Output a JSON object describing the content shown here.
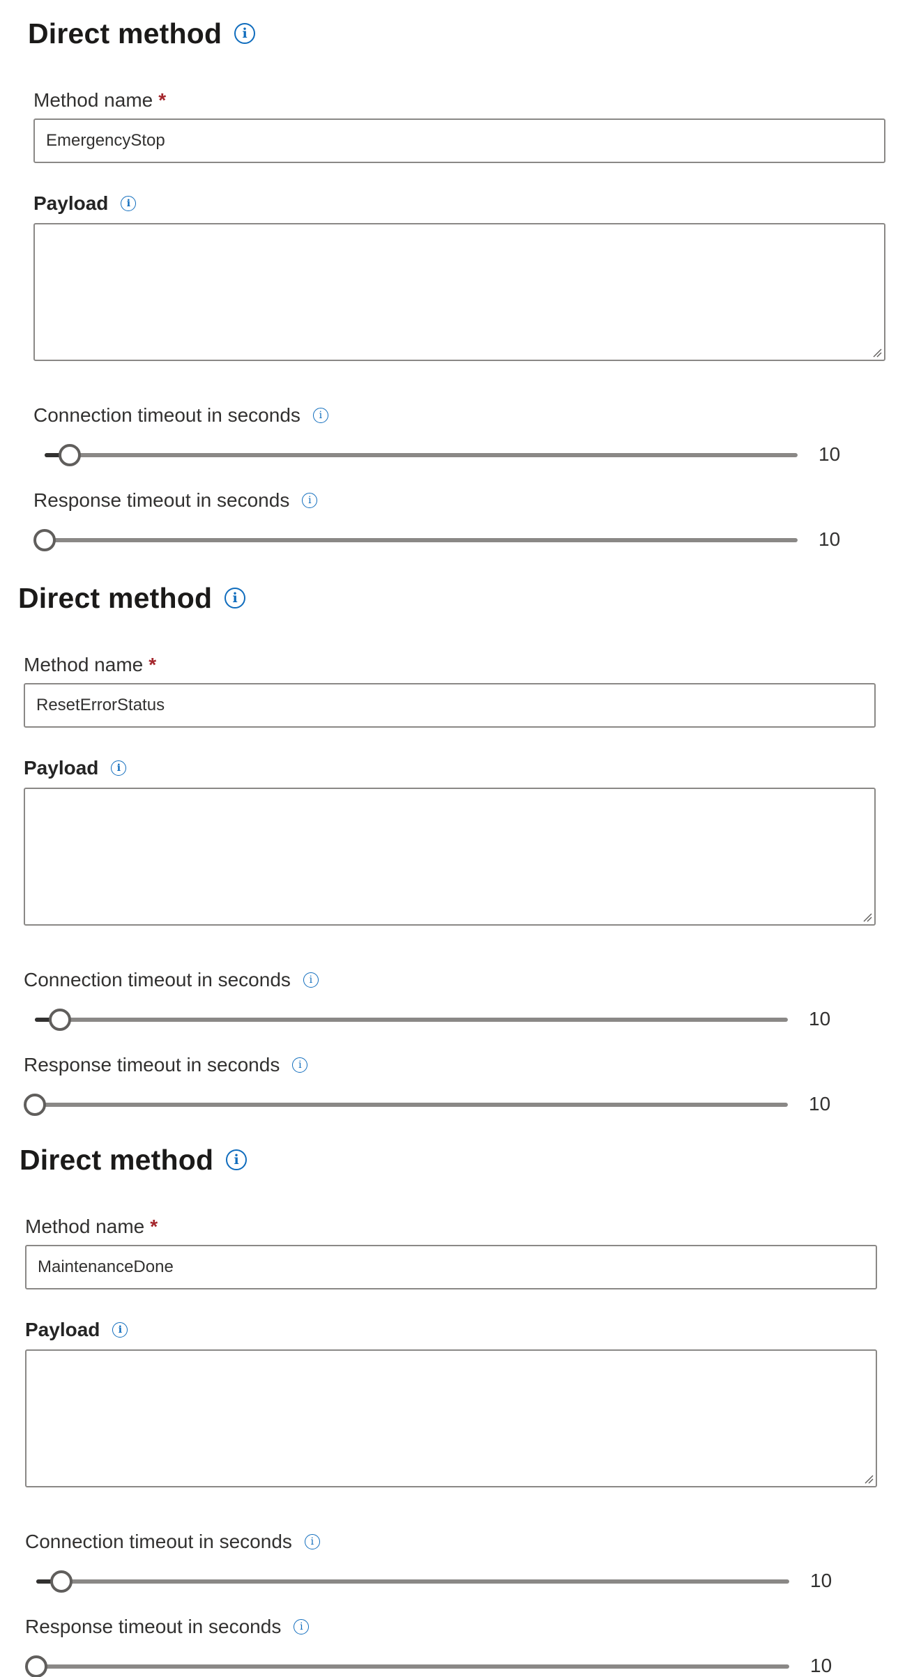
{
  "sections": [
    {
      "title": "Direct method",
      "method_name": {
        "label": "Method name",
        "required_mark": "*",
        "value": "EmergencyStop"
      },
      "payload": {
        "label": "Payload",
        "value": ""
      },
      "connection_timeout": {
        "label": "Connection timeout in seconds",
        "value": "10",
        "level_fraction": 0.03
      },
      "response_timeout": {
        "label": "Response timeout in seconds",
        "value": "10",
        "level_fraction": 0.0
      }
    },
    {
      "title": "Direct method",
      "method_name": {
        "label": "Method name",
        "required_mark": "*",
        "value": "ResetErrorStatus"
      },
      "payload": {
        "label": "Payload",
        "value": ""
      },
      "connection_timeout": {
        "label": "Connection timeout in seconds",
        "value": "10",
        "level_fraction": 0.03
      },
      "response_timeout": {
        "label": "Response timeout in seconds",
        "value": "10",
        "level_fraction": 0.0
      }
    },
    {
      "title": "Direct method",
      "method_name": {
        "label": "Method name",
        "required_mark": "*",
        "value": "MaintenanceDone"
      },
      "payload": {
        "label": "Payload",
        "value": ""
      },
      "connection_timeout": {
        "label": "Connection timeout in seconds",
        "value": "10",
        "level_fraction": 0.03
      },
      "response_timeout": {
        "label": "Response timeout in seconds",
        "value": "10",
        "level_fraction": 0.0
      }
    }
  ],
  "icons": {
    "info": "info-icon",
    "resize": "resize-grip-icon"
  },
  "colors": {
    "info_blue": "#0f6cbd",
    "required_red": "#a4262c",
    "border": "#8a8886",
    "thumb": "#605e5c"
  }
}
